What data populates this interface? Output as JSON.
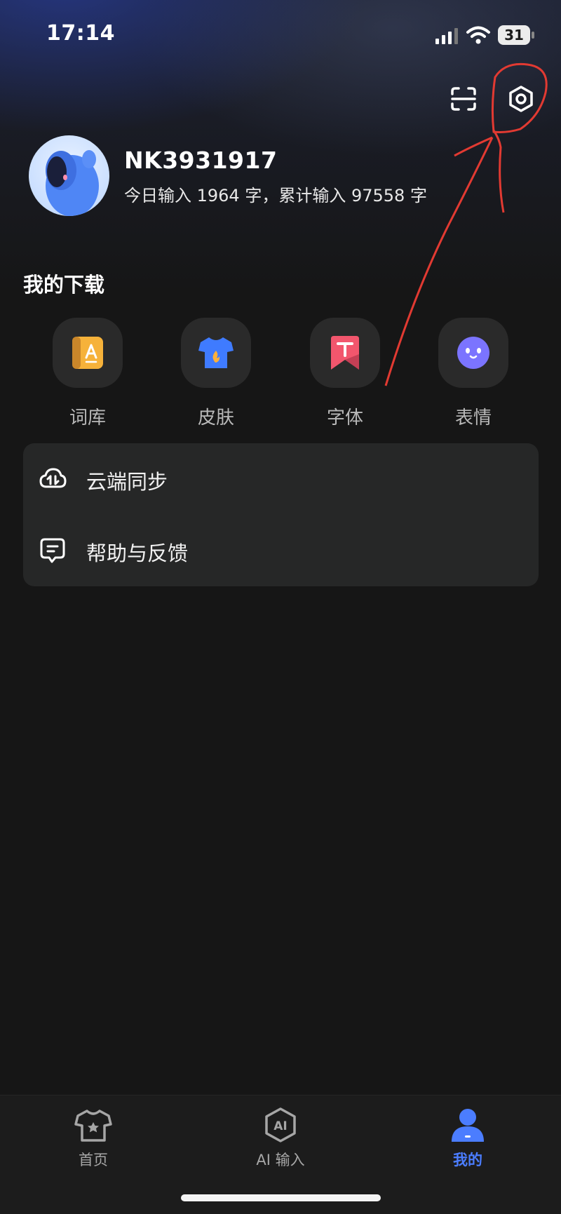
{
  "status_bar": {
    "time": "17:14",
    "battery": "31"
  },
  "profile": {
    "username": "NK3931917",
    "stats": "今日输入 1964 字，累计输入 97558 字"
  },
  "downloads": {
    "title": "我的下载",
    "items": [
      {
        "label": "词库",
        "icon": "book-icon",
        "color": "#f6b23a"
      },
      {
        "label": "皮肤",
        "icon": "tshirt-icon",
        "color": "#3f7bff"
      },
      {
        "label": "字体",
        "icon": "font-icon",
        "color": "#f2566d"
      },
      {
        "label": "表情",
        "icon": "emoji-face-icon",
        "color": "#7b74ff"
      }
    ]
  },
  "menu": [
    {
      "label": "云端同步",
      "icon": "cloud-sync-icon"
    },
    {
      "label": "帮助与反馈",
      "icon": "feedback-icon"
    }
  ],
  "tab_bar": {
    "tabs": [
      {
        "label": "首页",
        "icon": "home-shirt-icon",
        "active": false
      },
      {
        "label": "AI 输入",
        "icon": "ai-input-icon",
        "active": false
      },
      {
        "label": "我的",
        "icon": "profile-icon",
        "active": true
      }
    ]
  },
  "colors": {
    "accent": "#4b7dff",
    "annotation": "#e23a32",
    "background": "#161616"
  }
}
